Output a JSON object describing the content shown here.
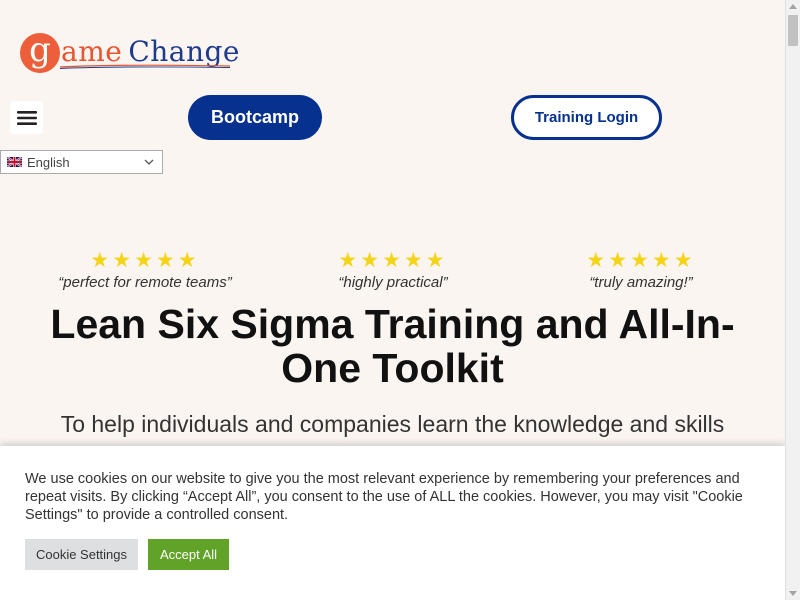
{
  "header": {
    "logo": {
      "letter": "g",
      "rest": "ame",
      "word2": "Change"
    },
    "menu_button_icon": "hamburger-icon",
    "bootcamp_label": "Bootcamp",
    "training_login_label": "Training Login"
  },
  "language": {
    "selected": "English",
    "flag_icon": "uk-flag-icon"
  },
  "testimonials": [
    {
      "stars": "★★★★★",
      "quote": "“perfect for remote teams”"
    },
    {
      "stars": "★★★★★",
      "quote": "“highly practical”"
    },
    {
      "stars": "★★★★★",
      "quote": "“truly amazing!”"
    }
  ],
  "hero": {
    "headline": "Lean Six Sigma Training and All-In-One Toolkit",
    "subline": "To help individuals and companies learn the knowledge and skills"
  },
  "cookie": {
    "text": "We use cookies on our website to give you the most relevant experience by remembering your preferences and repeat visits. By clicking “Accept All”, you consent to the use of ALL the cookies. However, you may visit \"Cookie Settings\" to provide a controlled consent.",
    "settings_label": "Cookie Settings",
    "accept_label": "Accept All"
  },
  "colors": {
    "brand_blue": "#06318e",
    "brand_orange": "#ec5f3a",
    "accept_green": "#61a229",
    "star_yellow": "#f4d418",
    "background": "#faf5f1"
  }
}
